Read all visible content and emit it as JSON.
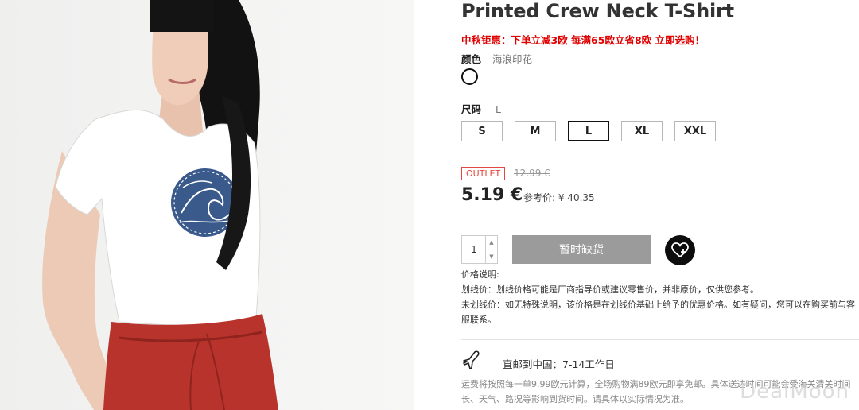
{
  "product": {
    "title": "Printed Crew Neck T-Shirt",
    "promo": "中秋钜惠：下单立减3欧 每满65欧立省8欧 立即选购！",
    "color_label": "颜色",
    "color_value": "海浪印花",
    "size_label": "尺码",
    "size_value": "L",
    "sizes": [
      "S",
      "M",
      "L",
      "XL",
      "XXL"
    ],
    "selected_size": "L",
    "outlet_badge": "OUTLET",
    "old_price": "12.99 €",
    "price": "5.19 €",
    "ref_price": "参考价: ¥ 40.35"
  },
  "purchase": {
    "quantity": "1",
    "soldout_label": "暂时缺货",
    "wishlist_icon": "heart-plus-icon"
  },
  "price_note": {
    "heading": "价格说明:",
    "line1": "划线价：划线价格可能是厂商指导价或建议零售价，并非原价，仅供您参考。",
    "line2": "未划线价：如无特殊说明，该价格是在划线价基础上给予的优惠价格。如有疑问，您可以在购买前与客服联系。"
  },
  "shipping": {
    "icon": "airplane-icon",
    "text": "直邮到中国：7-14工作日",
    "note": "运费将按照每一单9.99欧元计算，全场购物满89欧元即享免邮。具体送达时间可能会受海关清关时间长、天气、路况等影响到货时间。请具体以实际情况为准。"
  },
  "watermark": "DealMoon"
}
